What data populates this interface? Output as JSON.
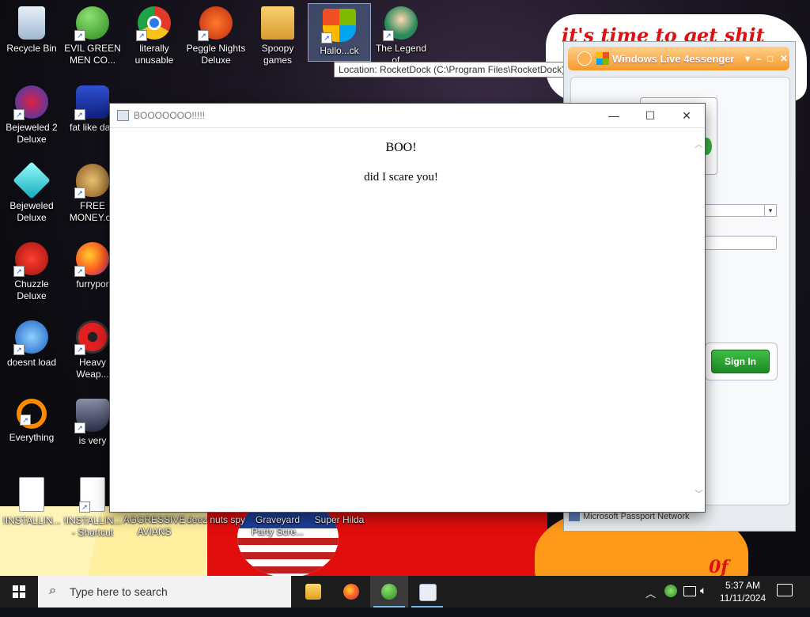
{
  "wallpaper": {
    "banner_text": "it's time to get shit",
    "bottom_right_text": "0f"
  },
  "desktop": {
    "icons": [
      {
        "label": "Recycle Bin"
      },
      {
        "label": "EVIL GREEN\nMEN CO..."
      },
      {
        "label": "literally\nunusable"
      },
      {
        "label": "Peggle Nights\nDeluxe"
      },
      {
        "label": "Spoopy\ngames"
      },
      {
        "label": "Hallo...ck"
      },
      {
        "label": "The Legend\nof ..."
      },
      {
        "label": "Bejeweled 2\nDeluxe"
      },
      {
        "label": "fat like darl"
      },
      {
        "label": "Bejeweled\nDeluxe"
      },
      {
        "label": "FREE\nMONEY.co"
      },
      {
        "label": "Chuzzle\nDeluxe"
      },
      {
        "label": "furrypor"
      },
      {
        "label": "doesnt load"
      },
      {
        "label": "Heavy\nWeap..."
      },
      {
        "label": "Everything"
      },
      {
        "label": "is very"
      },
      {
        "label": "!INSTALLIN..."
      },
      {
        "label": "!INSTALLIN...\n- Shortcut"
      },
      {
        "label": "AGGRESSIVE\nAVIANS"
      },
      {
        "label": "deez nuts spy"
      },
      {
        "label": "Graveyard\nParty Scre..."
      },
      {
        "label": "Super Hilda"
      }
    ],
    "tooltip": "Location: RocketDock (C:\\Program Files\\RocketDock)"
  },
  "messenger": {
    "title": "Windows Live 4essenger",
    "sign_in_label": "Sign In",
    "footer": "Microsoft Passport Network"
  },
  "popup": {
    "title": "BOOOOOOO!!!!!",
    "heading": "BOO!",
    "message": "did I scare you!"
  },
  "taskbar": {
    "search_placeholder": "Type here to search",
    "apps": [
      "file-explorer",
      "firefox",
      "evil-green-men",
      "popup-window"
    ],
    "time": "5:37 AM",
    "date": "11/11/2024"
  },
  "colors": {
    "taskbar_bg": "#1c1c1c",
    "msn_title": "#f49a2a",
    "sign_in_green": "#2aa030",
    "wallpaper_red": "#e20d0d",
    "pumpkin_orange": "#ff9a1a"
  }
}
